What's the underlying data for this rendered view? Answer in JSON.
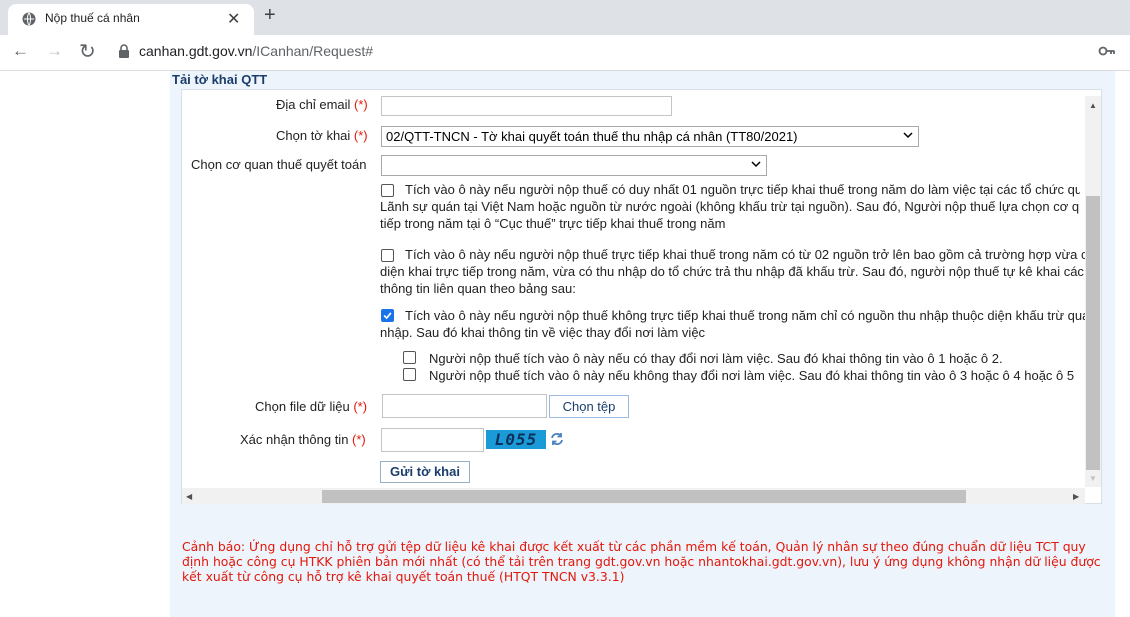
{
  "browser": {
    "tab_title": "Nộp thuế cá nhân",
    "url_host": "canhan.gdt.gov.vn",
    "url_path": "/ICanhan/Request#"
  },
  "panel": {
    "title": "Tải tờ khai QTT"
  },
  "form": {
    "email_label": "Địa chỉ email",
    "required_mark": "(*)",
    "email_value": "",
    "declaration_label": "Chọn tờ khai",
    "declaration_value": "02/QTT-TNCN - Tờ khai quyết toán thuế thu nhập cá nhân (TT80/2021)",
    "tax_office_label": "Chọn cơ quan thuế quyết toán",
    "tax_office_value": "",
    "option1": {
      "checked": false,
      "lines": [
        "Tích vào ô này nếu người nộp thuế có duy nhất 01 nguồn trực tiếp khai thuế trong năm do làm việc tại các tổ chức quốc tế,",
        "Lãnh sự quán tại Việt Nam hoặc nguồn từ nước ngoài (không khấu trừ tại nguồn). Sau đó, Người nộp thuế lựa chọn cơ quan",
        "tiếp trong năm tại ô “Cục thuế” trực tiếp khai thuế trong năm"
      ]
    },
    "option2": {
      "checked": false,
      "lines": [
        "Tích vào ô này nếu người nộp thuế trực tiếp khai thuế trong năm có từ 02 nguồn trở lên bao gồm cả trường hợp vừa có thu nhập thuộc",
        "diện khai trực tiếp trong năm, vừa có thu nhập do tổ chức trả thu nhập đã khấu trừ. Sau đó, người nộp thuế tự kê khai các",
        "thông tin liên quan theo bảng sau:"
      ]
    },
    "option3": {
      "checked": true,
      "lines": [
        "Tích vào ô này nếu người nộp thuế không trực tiếp khai thuế trong năm chỉ có nguồn thu nhập thuộc diện khấu trừ qua tổ chức trả thu",
        "nhập. Sau đó khai thông tin về việc thay đổi nơi làm việc"
      ]
    },
    "sub_option1": {
      "checked": false,
      "text": "Người nộp thuế tích vào ô này nếu có thay đổi nơi làm việc. Sau đó khai thông tin vào ô 1 hoặc ô 2."
    },
    "sub_option2": {
      "checked": false,
      "text": "Người nộp thuế tích vào ô này nếu không thay đổi nơi làm việc. Sau đó khai thông tin vào ô 3 hoặc ô 4 hoặc ô 5"
    },
    "file_label": "Chọn file dữ liệu",
    "file_button": "Chọn tệp",
    "captcha_label": "Xác nhận thông tin",
    "captcha_value": "",
    "captcha_text": "L055",
    "submit_button": "Gửi tờ khai"
  },
  "warning": "Cảnh báo: Ứng dụng chỉ hỗ trợ gửi tệp dữ liệu kê khai được kết xuất từ các phần mềm kế toán, Quản lý nhân sự theo đúng chuẩn dữ liệu TCT quy định hoặc công cụ HTKK phiên bản mới nhất (có thể tải trên trang gdt.gov.vn hoặc nhantokhai.gdt.gov.vn), lưu ý ứng dụng không nhận dữ liệu được kết xuất từ công cụ hỗ trợ kê khai quyết toán thuế (HTQT TNCN v3.3.1)",
  "colors": {
    "required": "#e3170a",
    "panel_bg": "#eef4fb",
    "checkbox_checked": "#1a73e8",
    "captcha_bg": "#1a9ad6"
  },
  "icons": [
    "globe-icon",
    "close-icon",
    "plus-icon",
    "back-arrow-icon",
    "forward-arrow-icon",
    "reload-icon",
    "lock-icon",
    "key-icon",
    "chevron-down-icon",
    "refresh-icon",
    "check-icon"
  ]
}
